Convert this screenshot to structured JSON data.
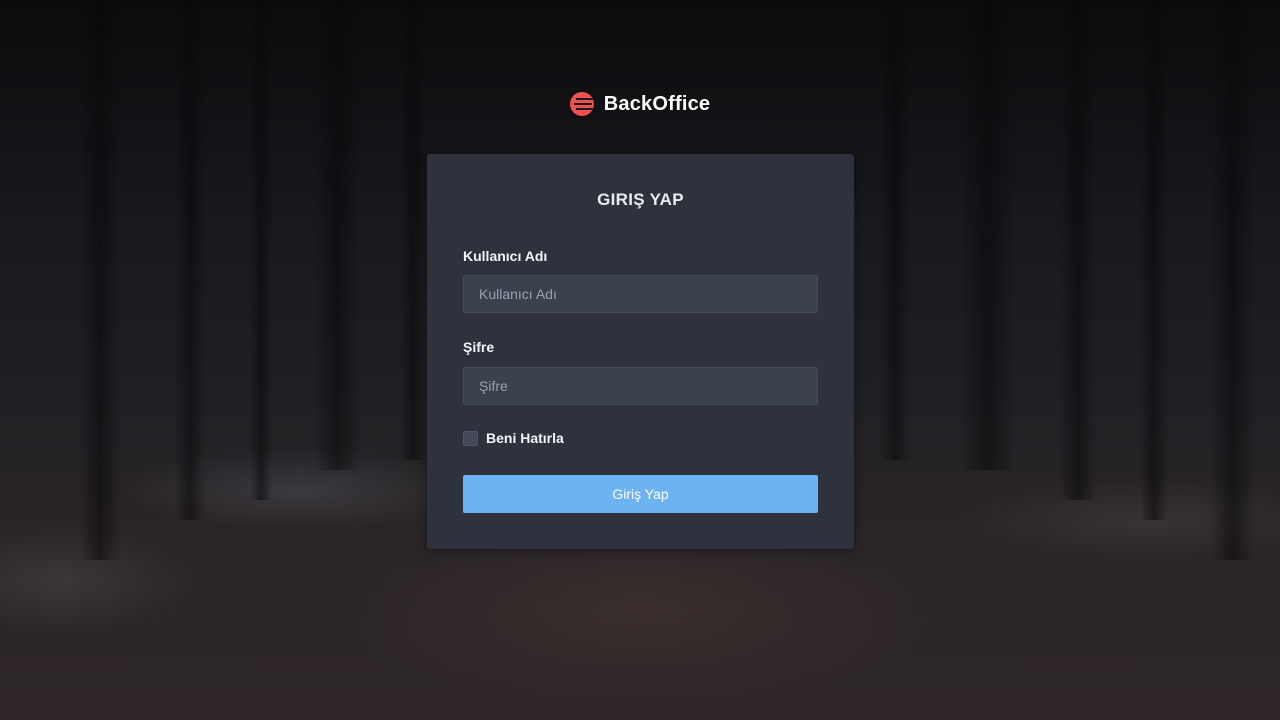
{
  "brand": {
    "name": "BackOffice",
    "icon": "backoffice-logo-icon",
    "color": "#ef4f4f"
  },
  "login": {
    "title": "GIRIŞ YAP",
    "username_label": "Kullanıcı Adı",
    "username_placeholder": "Kullanıcı Adı",
    "username_value": "",
    "password_label": "Şifre",
    "password_placeholder": "Şifre",
    "password_value": "",
    "remember_label": "Beni Hatırla",
    "remember_checked": false,
    "submit_label": "Giriş Yap"
  },
  "colors": {
    "card_background": "#2d323c",
    "input_background": "#3b414d",
    "button_primary": "#6db3f2"
  }
}
